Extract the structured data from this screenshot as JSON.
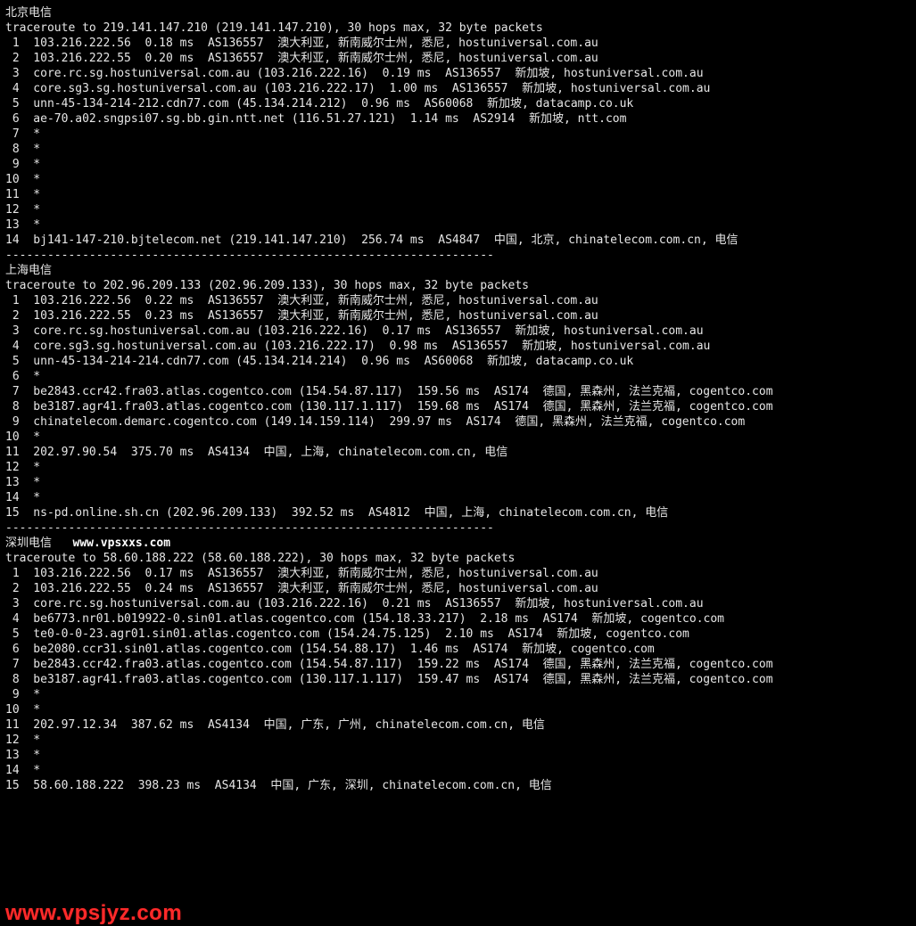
{
  "watermark_inline": "www.vpsxxs.com",
  "watermark_fixed": "www.vpsjyz.com",
  "separator": "----------------------------------------------------------------------",
  "traces": [
    {
      "title": "北京电信",
      "header": "traceroute to 219.141.147.210 (219.141.147.210), 30 hops max, 32 byte packets",
      "hops": [
        {
          "n": 1,
          "t": "103.216.222.56  0.18 ms  AS136557  澳大利亚, 新南威尔士州, 悉尼, hostuniversal.com.au"
        },
        {
          "n": 2,
          "t": "103.216.222.55  0.20 ms  AS136557  澳大利亚, 新南威尔士州, 悉尼, hostuniversal.com.au"
        },
        {
          "n": 3,
          "t": "core.rc.sg.hostuniversal.com.au (103.216.222.16)  0.19 ms  AS136557  新加坡, hostuniversal.com.au"
        },
        {
          "n": 4,
          "t": "core.sg3.sg.hostuniversal.com.au (103.216.222.17)  1.00 ms  AS136557  新加坡, hostuniversal.com.au"
        },
        {
          "n": 5,
          "t": "unn-45-134-214-212.cdn77.com (45.134.214.212)  0.96 ms  AS60068  新加坡, datacamp.co.uk"
        },
        {
          "n": 6,
          "t": "ae-70.a02.sngpsi07.sg.bb.gin.ntt.net (116.51.27.121)  1.14 ms  AS2914  新加坡, ntt.com"
        },
        {
          "n": 7,
          "t": "*"
        },
        {
          "n": 8,
          "t": "*"
        },
        {
          "n": 9,
          "t": "*"
        },
        {
          "n": 10,
          "t": "*"
        },
        {
          "n": 11,
          "t": "*"
        },
        {
          "n": 12,
          "t": "*"
        },
        {
          "n": 13,
          "t": "*"
        },
        {
          "n": 14,
          "t": "bj141-147-210.bjtelecom.net (219.141.147.210)  256.74 ms  AS4847  中国, 北京, chinatelecom.com.cn, 电信"
        }
      ]
    },
    {
      "title": "上海电信",
      "header": "traceroute to 202.96.209.133 (202.96.209.133), 30 hops max, 32 byte packets",
      "hops": [
        {
          "n": 1,
          "t": "103.216.222.56  0.22 ms  AS136557  澳大利亚, 新南威尔士州, 悉尼, hostuniversal.com.au"
        },
        {
          "n": 2,
          "t": "103.216.222.55  0.23 ms  AS136557  澳大利亚, 新南威尔士州, 悉尼, hostuniversal.com.au"
        },
        {
          "n": 3,
          "t": "core.rc.sg.hostuniversal.com.au (103.216.222.16)  0.17 ms  AS136557  新加坡, hostuniversal.com.au"
        },
        {
          "n": 4,
          "t": "core.sg3.sg.hostuniversal.com.au (103.216.222.17)  0.98 ms  AS136557  新加坡, hostuniversal.com.au"
        },
        {
          "n": 5,
          "t": "unn-45-134-214-214.cdn77.com (45.134.214.214)  0.96 ms  AS60068  新加坡, datacamp.co.uk"
        },
        {
          "n": 6,
          "t": "*"
        },
        {
          "n": 7,
          "t": "be2843.ccr42.fra03.atlas.cogentco.com (154.54.87.117)  159.56 ms  AS174  德国, 黑森州, 法兰克福, cogentco.com"
        },
        {
          "n": 8,
          "t": "be3187.agr41.fra03.atlas.cogentco.com (130.117.1.117)  159.68 ms  AS174  德国, 黑森州, 法兰克福, cogentco.com"
        },
        {
          "n": 9,
          "t": "chinatelecom.demarc.cogentco.com (149.14.159.114)  299.97 ms  AS174  德国, 黑森州, 法兰克福, cogentco.com"
        },
        {
          "n": 10,
          "t": "*"
        },
        {
          "n": 11,
          "t": "202.97.90.54  375.70 ms  AS4134  中国, 上海, chinatelecom.com.cn, 电信"
        },
        {
          "n": 12,
          "t": "*"
        },
        {
          "n": 13,
          "t": "*"
        },
        {
          "n": 14,
          "t": "*"
        },
        {
          "n": 15,
          "t": "ns-pd.online.sh.cn (202.96.209.133)  392.52 ms  AS4812  中国, 上海, chinatelecom.com.cn, 电信"
        }
      ]
    },
    {
      "title": "深圳电信",
      "title_has_watermark": true,
      "header": "traceroute to 58.60.188.222 (58.60.188.222), 30 hops max, 32 byte packets",
      "hops": [
        {
          "n": 1,
          "t": "103.216.222.56  0.17 ms  AS136557  澳大利亚, 新南威尔士州, 悉尼, hostuniversal.com.au"
        },
        {
          "n": 2,
          "t": "103.216.222.55  0.24 ms  AS136557  澳大利亚, 新南威尔士州, 悉尼, hostuniversal.com.au"
        },
        {
          "n": 3,
          "t": "core.rc.sg.hostuniversal.com.au (103.216.222.16)  0.21 ms  AS136557  新加坡, hostuniversal.com.au"
        },
        {
          "n": 4,
          "t": "be6773.nr01.b019922-0.sin01.atlas.cogentco.com (154.18.33.217)  2.18 ms  AS174  新加坡, cogentco.com"
        },
        {
          "n": 5,
          "t": "te0-0-0-23.agr01.sin01.atlas.cogentco.com (154.24.75.125)  2.10 ms  AS174  新加坡, cogentco.com"
        },
        {
          "n": 6,
          "t": "be2080.ccr31.sin01.atlas.cogentco.com (154.54.88.17)  1.46 ms  AS174  新加坡, cogentco.com"
        },
        {
          "n": 7,
          "t": "be2843.ccr42.fra03.atlas.cogentco.com (154.54.87.117)  159.22 ms  AS174  德国, 黑森州, 法兰克福, cogentco.com"
        },
        {
          "n": 8,
          "t": "be3187.agr41.fra03.atlas.cogentco.com (130.117.1.117)  159.47 ms  AS174  德国, 黑森州, 法兰克福, cogentco.com"
        },
        {
          "n": 9,
          "t": "*"
        },
        {
          "n": 10,
          "t": "*"
        },
        {
          "n": 11,
          "t": "202.97.12.34  387.62 ms  AS4134  中国, 广东, 广州, chinatelecom.com.cn, 电信"
        },
        {
          "n": 12,
          "t": "*"
        },
        {
          "n": 13,
          "t": "*"
        },
        {
          "n": 14,
          "t": "*"
        },
        {
          "n": 15,
          "t": "58.60.188.222  398.23 ms  AS4134  中国, 广东, 深圳, chinatelecom.com.cn, 电信"
        }
      ]
    }
  ]
}
